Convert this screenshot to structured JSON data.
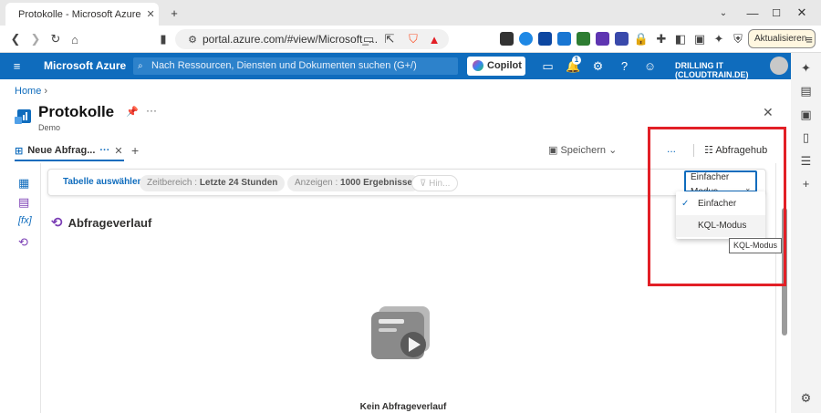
{
  "browser": {
    "tab_title": "Protokolle - Microsoft Azure",
    "new_tab_label": "+",
    "url": "portal.azure.com/#view/Microsoft_...",
    "update_label": "Aktualisieren"
  },
  "azure_header": {
    "brand": "Microsoft Azure",
    "search_placeholder": "Nach Ressourcen, Diensten und Dokumenten suchen (G+/)",
    "copilot_label": "Copilot",
    "notification_count": "1",
    "account": "DRILLING IT (CLOUDTRAIN.DE)"
  },
  "page": {
    "breadcrumb": "Home",
    "title": "Protokolle",
    "subtitle": "Demo",
    "query_tab": "Neue Abfrag...",
    "save_label": "Speichern",
    "more_label": "...",
    "query_hub": "Abfragehub"
  },
  "query_bar": {
    "select_table": "Tabelle auswählen",
    "time_range_label": "Zeitbereich : ",
    "time_range_value": "Letzte 24 Stunden",
    "show_label": "Anzeigen : ",
    "show_value": "1000 Ergebnisse",
    "add_filter": "Hin..."
  },
  "mode_dropdown": {
    "selected": "Einfacher Modus",
    "options": [
      "Einfacher Modus",
      "KQL-Modus"
    ],
    "tooltip": "KQL-Modus"
  },
  "history": {
    "title": "Abfrageverlauf",
    "empty_text": "Kein Abfrageverlauf"
  },
  "colors": {
    "azure_blue": "#0f6cbd",
    "highlight_red": "#e21f26"
  }
}
